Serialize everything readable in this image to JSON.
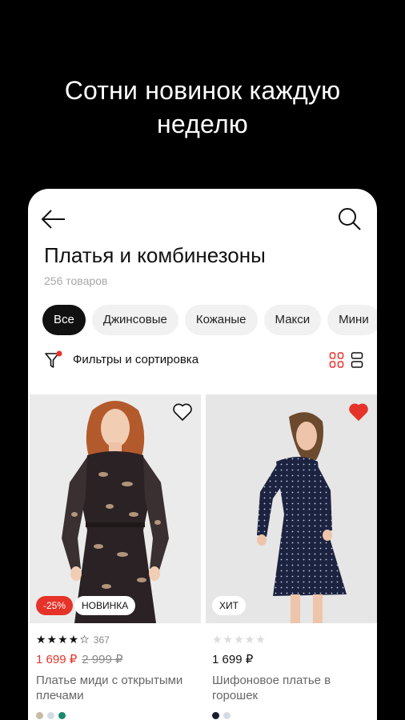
{
  "promo": {
    "line1": "Сотни новинок каждую",
    "line2": "неделю"
  },
  "header": {
    "title": "Платья и комбинезоны",
    "count": "256 товаров"
  },
  "chips": [
    {
      "label": "Все",
      "active": true
    },
    {
      "label": "Джинсовые",
      "active": false
    },
    {
      "label": "Кожаные",
      "active": false
    },
    {
      "label": "Макси",
      "active": false
    },
    {
      "label": "Мини",
      "active": false
    }
  ],
  "filters": {
    "label": "Фильтры и сортировка"
  },
  "products": [
    {
      "favorite": false,
      "badges": [
        "-25%",
        "НОВИНКА"
      ],
      "stars_text": "★★★★☆",
      "rating_count": "367",
      "price": "1 699 ₽",
      "old_price": "2 999 ₽",
      "name": "Платье миди с открытыми плечами",
      "swatch_colors": [
        "#c8bca8",
        "#d4dbe3",
        "#1a8a6e"
      ]
    },
    {
      "favorite": true,
      "badges": [
        "ХИТ"
      ],
      "stars_text": "★★★★★",
      "rating_count": "",
      "price": "1 699 ₽",
      "old_price": "",
      "name": "Шифоновое платье в горошек",
      "swatch_colors": [
        "#1a1c2e",
        "#d4dbe3"
      ]
    }
  ],
  "colors": {
    "accent": "#e5332a",
    "background": "#000000",
    "card_bg": "#ffffff"
  }
}
